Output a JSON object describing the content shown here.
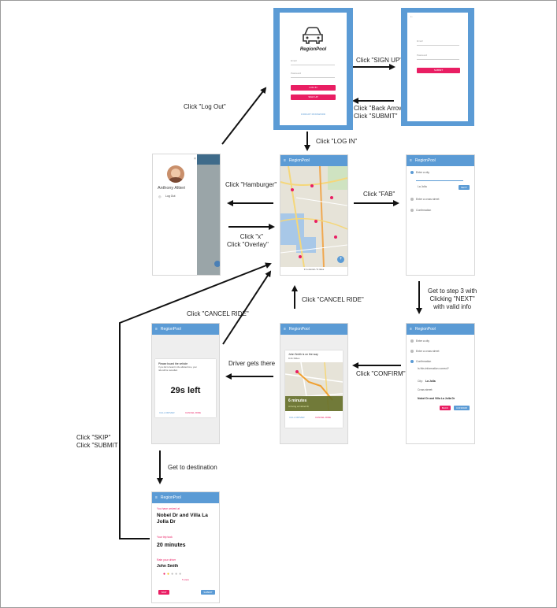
{
  "labels": {
    "log_out": "Click \"Log Out\"",
    "sign_up": "Click \"SIGN UP\"",
    "back_arrow": "Click \"Back Arrow\"",
    "submit_1": "Click \"SUBMIT\"",
    "log_in": "Click \"LOG IN\"",
    "hamburger": "Click \"Hamburger\"",
    "fab": "Click \"FAB\"",
    "click_x": "Click \"x\"",
    "click_overlay": "Click \"Overlay\"",
    "step3_line1": "Get to step 3 with",
    "step3_line2": "Clicking \"NEXT\"",
    "step3_line3": "with valid info",
    "cancel_ride_left": "Click \"CANCEL RIDE\"",
    "cancel_ride_center": "Click \"CANCEL RIDE\"",
    "driver_gets_there": "Driver gets there",
    "confirm": "Click \"CONFIRM\"",
    "skip": "Click \"SKIP\"",
    "submit_2": "Click \"SUBMIT",
    "get_to_destination": "Get to destination"
  },
  "login_screen": {
    "app_name": "RegionPool",
    "email_placeholder": "Email",
    "password_placeholder": "Password",
    "login_button": "LOG IN",
    "signup_button": "SIGN UP",
    "forgot_link": "FORGOT PASSWORD"
  },
  "signup_screen": {
    "back": "←",
    "email_placeholder": "Email",
    "password_placeholder": "Password",
    "submit_button": "SUBMIT"
  },
  "drawer_screen": {
    "close": "×",
    "user_name": "Anthony Altieri",
    "log_out": "Log Out"
  },
  "map_screen": {
    "title": "RegionPool",
    "footer": "9 in-transit / 9 rides"
  },
  "form_screen": {
    "title": "RegionPool",
    "step1": "Enter a city",
    "step1_value": "La Jolla",
    "next_button": "NEXT",
    "step2": "Enter a cross street",
    "step3": "Confirmation"
  },
  "confirm_screen": {
    "title": "RegionPool",
    "step1": "Enter a city",
    "step2": "Enter a cross street",
    "step3": "Confirmation",
    "question": "Is this information correct?",
    "city_label": "City:",
    "city_value": "La Jolla",
    "cross_label": "Cross street:",
    "cross_value": "Nobel Dr and Villa La Jolla Dr",
    "back_button": "BACK",
    "confirm_button": "CONFIRM"
  },
  "waiting_screen": {
    "title": "RegionPool",
    "heading": "John Smith is on the way",
    "sub": "9:41 Rides",
    "eta": "6 minutes",
    "eta_sub": "Arriving at Nobel Dr",
    "call_button": "CALL DRIVER",
    "cancel_button": "CANCEL RIDE"
  },
  "arrived_screen": {
    "title": "RegionPool",
    "message_1": "Please board the vehicle",
    "message_2": "If you fail to board in the allotted time, your ride will be cancelled.",
    "countdown": "29s left",
    "call_button": "CALL DRIVER",
    "cancel_button": "CANCEL RIDE"
  },
  "rating_screen": {
    "title": "RegionPool",
    "arrived_label": "You have arrived at",
    "destination": "Nobel Dr and Villa La Jolla Dr",
    "time_label": "Your trip took",
    "duration": "20 minutes",
    "rate_label": "Rate your driver",
    "driver": "John Smith",
    "stars_label": "5 stars",
    "skip_button": "SKIP",
    "submit_button": "SUBMIT"
  },
  "colors": {
    "primary": "#5b9bd5",
    "accent": "#e91e63",
    "arrow": "#111111"
  }
}
